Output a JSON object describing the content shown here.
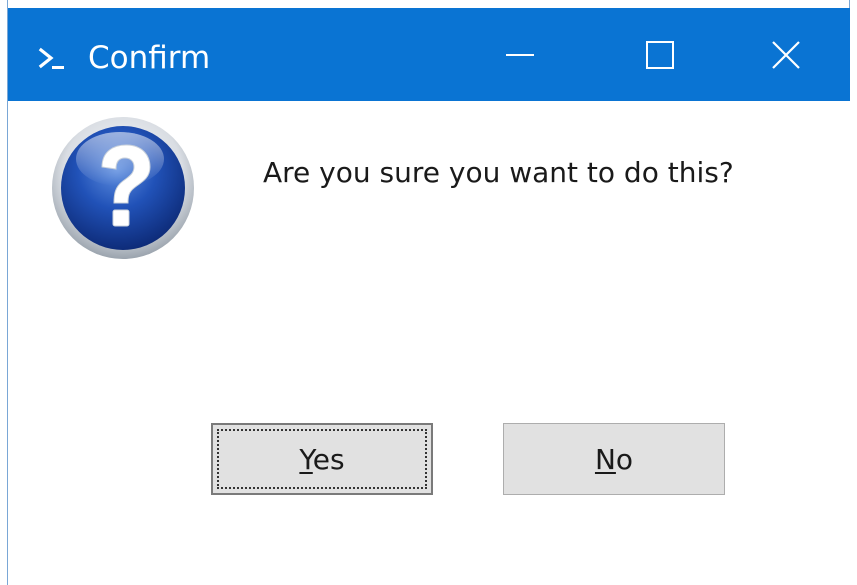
{
  "window": {
    "title": "Confirm",
    "titlebar_color": "#0a74d3",
    "icons": {
      "app": "powershell-icon",
      "minimize": "minimize-icon",
      "maximize": "maximize-icon",
      "close": "close-icon",
      "dialog": "question-icon"
    }
  },
  "dialog": {
    "message": "Are you sure you want to do this?",
    "buttons": {
      "yes": {
        "mnemonic": "Y",
        "rest": "es"
      },
      "no": {
        "mnemonic": "N",
        "rest": "o"
      }
    }
  }
}
